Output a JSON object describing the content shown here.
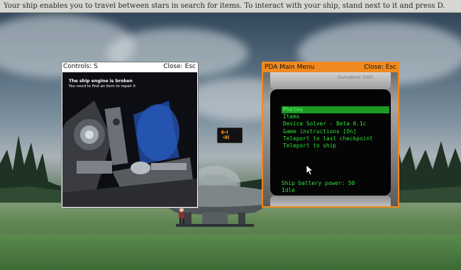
{
  "instruction": "Your ship enables you to travel between stars in search for items. To interact with your ship, stand next to it and press D.",
  "photo_window": {
    "controls_label": "Controls: S",
    "close_label": "Close: Esc",
    "title": "The ship engine is broken",
    "subtitle": "You need to find an item to repair it"
  },
  "pda_window": {
    "title": "PDA Main Menu",
    "close_label": "Close: Esc",
    "brand": "GameBoxx 3000",
    "menu": [
      {
        "label": "Photos",
        "selected": true
      },
      {
        "label": "Items",
        "selected": false
      },
      {
        "label": "Device Solver - Beta 0.1c",
        "selected": false
      },
      {
        "label": "Game instructions [On]",
        "selected": false
      },
      {
        "label": "Teleport to last checkpoint",
        "selected": false
      },
      {
        "label": "Teleport to ship",
        "selected": false
      }
    ],
    "battery": "Ship battery power: 50",
    "state": "Idle"
  },
  "colors": {
    "pda_accent": "#f0891f",
    "pda_text": "#30e23a",
    "pda_highlight": "#1c9a24"
  },
  "icons": [
    "transfer-arrows-icon",
    "mouse-cursor-icon"
  ]
}
